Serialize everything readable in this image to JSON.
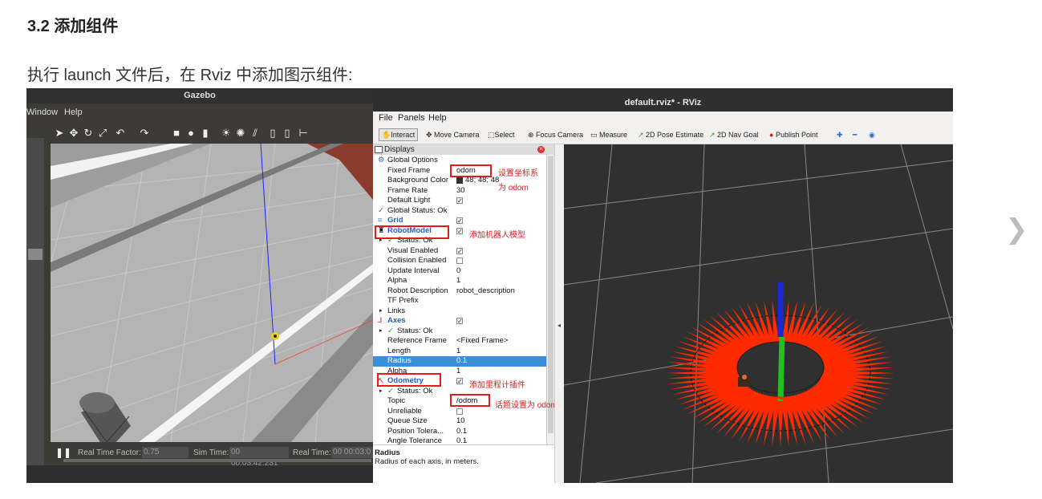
{
  "page": {
    "heading": "3.2 添加组件",
    "paragraph": "执行 launch 文件后，在 Rviz 中添加图示组件:"
  },
  "gazebo": {
    "title": "Gazebo",
    "menu": [
      "Window",
      "Help"
    ],
    "status": {
      "rtf_label": "Real Time Factor:",
      "rtf_value": "0.75",
      "sim_label": "Sim Time:",
      "sim_value": "00 00:03:42.231",
      "real_label": "Real Time:",
      "real_value": "00 00:03:0"
    }
  },
  "rviz": {
    "title": "default.rviz* - RViz",
    "menu": [
      "File",
      "Panels",
      "Help"
    ],
    "toolbar": {
      "interact": "Interact",
      "move_camera": "Move Camera",
      "select": "Select",
      "focus_camera": "Focus Camera",
      "measure": "Measure",
      "pose_estimate": "2D Pose Estimate",
      "nav_goal": "2D Nav Goal",
      "publish_point": "Publish Point"
    },
    "displays": {
      "title": "Displays",
      "rows": [
        {
          "key": "Global Options",
          "value": ""
        },
        {
          "key": "Fixed Frame",
          "value": "odom"
        },
        {
          "key": "Background Color",
          "value": "48; 48; 48"
        },
        {
          "key": "Frame Rate",
          "value": "30"
        },
        {
          "key": "Default Light",
          "value": "✓"
        },
        {
          "key": "Global Status: Ok",
          "value": ""
        },
        {
          "key": "Grid",
          "value": "✓"
        },
        {
          "key": "RobotModel",
          "value": "✓"
        },
        {
          "key": "Status: Ok",
          "value": ""
        },
        {
          "key": "Visual Enabled",
          "value": "✓"
        },
        {
          "key": "Collision Enabled",
          "value": ""
        },
        {
          "key": "Update Interval",
          "value": "0"
        },
        {
          "key": "Alpha",
          "value": "1"
        },
        {
          "key": "Robot Description",
          "value": "robot_description"
        },
        {
          "key": "TF Prefix",
          "value": ""
        },
        {
          "key": "Links",
          "value": ""
        },
        {
          "key": "Axes",
          "value": "✓"
        },
        {
          "key": "Status: Ok",
          "value": ""
        },
        {
          "key": "Reference Frame",
          "value": "<Fixed Frame>"
        },
        {
          "key": "Length",
          "value": "1"
        },
        {
          "key": "Radius",
          "value": "0.1"
        },
        {
          "key": "Alpha",
          "value": "1"
        },
        {
          "key": "Odometry",
          "value": "✓"
        },
        {
          "key": "Status: Ok",
          "value": ""
        },
        {
          "key": "Topic",
          "value": "/odom"
        },
        {
          "key": "Unreliable",
          "value": ""
        },
        {
          "key": "Queue Size",
          "value": "10"
        },
        {
          "key": "Position Tolera...",
          "value": "0.1"
        },
        {
          "key": "Angle Tolerance",
          "value": "0.1"
        }
      ]
    },
    "description": {
      "title": "Radius",
      "text": "Radius of each axis, in meters."
    }
  },
  "annotations": {
    "fixed_frame_note_1": "设置坐标系",
    "fixed_frame_note_2": "为 odom",
    "robot_model_note": "添加机器人模型",
    "odometry_note": "添加里程计插件",
    "topic_note": "话题设置为 odom"
  },
  "colors": {
    "annotation_red": "#e31b1b",
    "selection_blue": "#3b8ed8",
    "rviz_bg": "#303030",
    "odom_arrow": "#ff2a00"
  },
  "icons": [
    "pointer-icon",
    "move-icon",
    "rotate-icon",
    "scale-icon",
    "undo-icon",
    "redo-icon",
    "box-icon",
    "sphere-icon",
    "cylinder-icon",
    "light-icon",
    "next-arrow-icon"
  ]
}
